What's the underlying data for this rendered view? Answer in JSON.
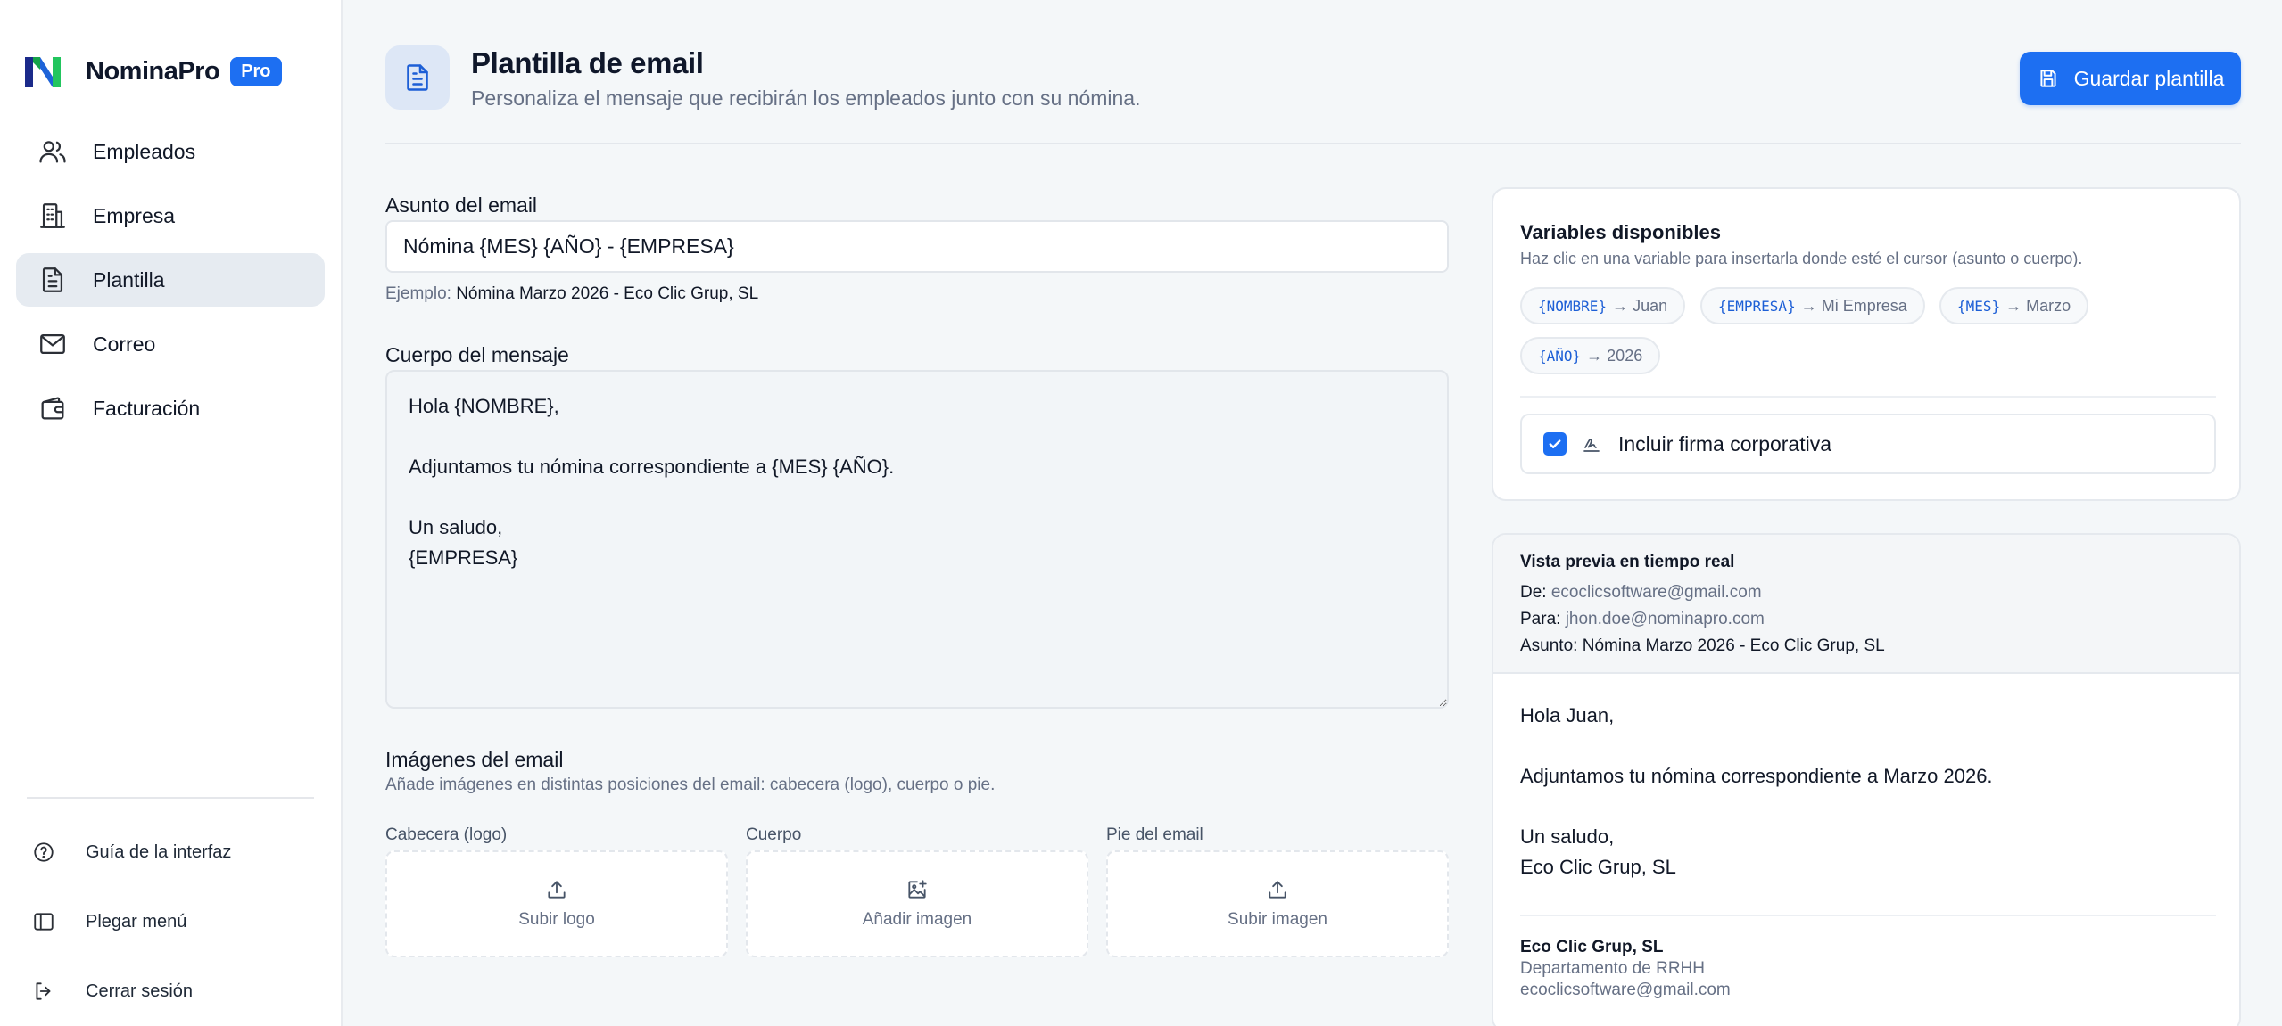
{
  "brand": {
    "name": "NominaPro",
    "badge": "Pro"
  },
  "nav": [
    {
      "label": "Empleados",
      "icon": "users-icon",
      "active": false
    },
    {
      "label": "Empresa",
      "icon": "building-icon",
      "active": false
    },
    {
      "label": "Plantilla",
      "icon": "file-text-icon",
      "active": true
    },
    {
      "label": "Correo",
      "icon": "mail-icon",
      "active": false
    },
    {
      "label": "Facturación",
      "icon": "wallet-icon",
      "active": false
    }
  ],
  "sidebar_footer": [
    {
      "label": "Guía de la interfaz",
      "icon": "help-circle-icon"
    },
    {
      "label": "Plegar menú",
      "icon": "sidebar-panel-icon"
    },
    {
      "label": "Cerrar sesión",
      "icon": "logout-icon"
    }
  ],
  "header": {
    "title": "Plantilla de email",
    "subtitle": "Personaliza el mensaje que recibirán los empleados junto con su nómina.",
    "save_label": "Guardar plantilla"
  },
  "subject": {
    "label": "Asunto del email",
    "value": "Nómina {MES} {AÑO} - {EMPRESA}",
    "example_prefix": "Ejemplo:",
    "example_value": "Nómina Marzo 2026 - Eco Clic Grup, SL"
  },
  "body": {
    "label": "Cuerpo del mensaje",
    "value": "Hola {NOMBRE},\n\nAdjuntamos tu nómina correspondiente a {MES} {AÑO}.\n\nUn saludo,\n{EMPRESA}"
  },
  "images": {
    "title": "Imágenes del email",
    "subtitle": "Añade imágenes en distintas posiciones del email: cabecera (logo), cuerpo o pie.",
    "slots": [
      {
        "label": "Cabecera (logo)",
        "action": "Subir logo",
        "icon": "upload-icon"
      },
      {
        "label": "Cuerpo",
        "action": "Añadir imagen",
        "icon": "image-plus-icon"
      },
      {
        "label": "Pie del email",
        "action": "Subir imagen",
        "icon": "upload-icon"
      }
    ]
  },
  "variables": {
    "title": "Variables disponibles",
    "subtitle": "Haz clic en una variable para insertarla donde esté el cursor (asunto o cuerpo).",
    "chips": [
      {
        "code": "{NOMBRE}",
        "example": "→ Juan"
      },
      {
        "code": "{EMPRESA}",
        "example": "→ Mi Empresa"
      },
      {
        "code": "{MES}",
        "example": "→ Marzo"
      },
      {
        "code": "{AÑO}",
        "example": "→ 2026"
      }
    ],
    "signature_label": "Incluir firma corporativa",
    "signature_checked": true
  },
  "preview": {
    "title": "Vista previa en tiempo real",
    "from_label": "De:",
    "from_value": "ecoclicsoftware@gmail.com",
    "to_label": "Para:",
    "to_value": "jhon.doe@nominapro.com",
    "subject_label": "Asunto:",
    "subject_value": "Nómina Marzo 2026 - Eco Clic Grup, SL",
    "body": "Hola Juan,\n\nAdjuntamos tu nómina correspondiente a Marzo 2026.\n\nUn saludo,\nEco Clic Grup, SL",
    "signature_name": "Eco Clic Grup, SL",
    "signature_dept": "Departamento de RRHH",
    "signature_email": "ecoclicsoftware@gmail.com"
  },
  "colors": {
    "primary": "#1d6ff2",
    "logo_dark": "#1b2a8a",
    "logo_green": "#22c55e"
  }
}
